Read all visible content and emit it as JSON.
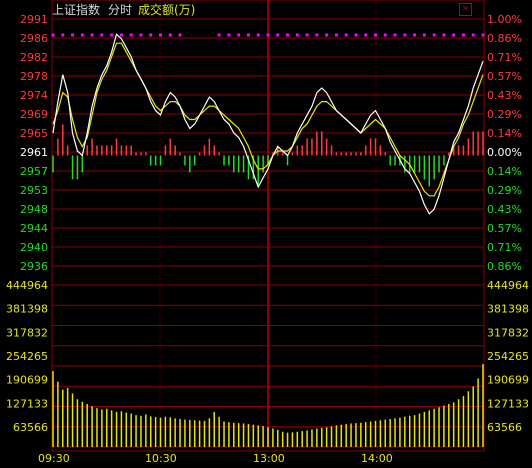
{
  "header": {
    "index_name": "上证指数",
    "mode": "分时",
    "volume_label": "成交额(万)",
    "close_glyph": "×"
  },
  "colors": {
    "background": "#000000",
    "grid": "#8b0000",
    "up": "#ff3b3b",
    "down": "#22dd22",
    "neutral": "#ffffff",
    "price_line": "#ffffff",
    "avg_line": "#e8e800",
    "volume_bar": "#e6e600",
    "magenta_marker": "#ff00ff",
    "time_label": "#e6e619"
  },
  "chart_data": {
    "type": "line",
    "prev_close": 2961,
    "price_axis": [
      "2991",
      "2986",
      "2982",
      "2978",
      "2974",
      "2969",
      "2965",
      "2961",
      "2957",
      "2953",
      "2948",
      "2944",
      "2940",
      "2936"
    ],
    "percent_axis": [
      "1.00%",
      "0.86%",
      "0.71%",
      "0.57%",
      "0.43%",
      "0.29%",
      "0.14%",
      "0.00%",
      "0.14%",
      "0.29%",
      "0.43%",
      "0.57%",
      "0.71%",
      "0.86%"
    ],
    "volume_axis": [
      "444964",
      "381398",
      "317832",
      "254265",
      "190699",
      "127133",
      "63566"
    ],
    "volume_max": 508530,
    "x_axis": [
      "09:30",
      "10:30",
      "13:00",
      "14:00"
    ],
    "series": [
      {
        "type": "line",
        "values": [
          2966,
          2973,
          2979,
          2975,
          2966,
          2962,
          2961,
          2966,
          2972,
          2976,
          2979,
          2981,
          2984,
          2988,
          2987,
          2985,
          2983,
          2980,
          2978,
          2976,
          2973,
          2971,
          2970,
          2973,
          2975,
          2974,
          2972,
          2969,
          2967,
          2968,
          2970,
          2972,
          2974,
          2973,
          2971,
          2969,
          2968,
          2966,
          2965,
          2963,
          2960,
          2957,
          2954,
          2956,
          2958,
          2961,
          2963,
          2962,
          2961,
          2963,
          2966,
          2968,
          2970,
          2972,
          2975,
          2976,
          2975,
          2973,
          2971,
          2970,
          2969,
          2968,
          2967,
          2966,
          2968,
          2970,
          2971,
          2969,
          2967,
          2964,
          2962,
          2960,
          2958,
          2957,
          2955,
          2953,
          2950,
          2948,
          2949,
          2952,
          2956,
          2960,
          2964,
          2966,
          2969,
          2972,
          2976,
          2979,
          2982
        ]
      },
      {
        "type": "line",
        "values": [
          2968,
          2971,
          2975,
          2974,
          2969,
          2965,
          2963,
          2965,
          2970,
          2975,
          2978,
          2980,
          2983,
          2986,
          2986,
          2984,
          2982,
          2980,
          2978,
          2976,
          2974,
          2972,
          2971,
          2972,
          2973,
          2973,
          2972,
          2970,
          2969,
          2969,
          2970,
          2971,
          2972,
          2972,
          2971,
          2970,
          2969,
          2968,
          2967,
          2965,
          2963,
          2960,
          2958,
          2958,
          2959,
          2961,
          2962,
          2962,
          2962,
          2963,
          2965,
          2967,
          2968,
          2970,
          2972,
          2973,
          2973,
          2972,
          2971,
          2970,
          2969,
          2968,
          2967,
          2966,
          2967,
          2968,
          2969,
          2968,
          2967,
          2965,
          2963,
          2961,
          2960,
          2959,
          2957,
          2955,
          2953,
          2952,
          2952,
          2954,
          2957,
          2960,
          2963,
          2965,
          2968,
          2970,
          2973,
          2976,
          2979
        ]
      },
      {
        "type": "bar",
        "values": [
          238000,
          205000,
          180000,
          185000,
          168000,
          150000,
          142000,
          135000,
          128000,
          122000,
          118000,
          120000,
          115000,
          110000,
          112000,
          108000,
          105000,
          100000,
          98000,
          102000,
          96000,
          94000,
          92000,
          95000,
          93000,
          90000,
          88000,
          86000,
          85000,
          84000,
          83000,
          82000,
          90000,
          110000,
          95000,
          80000,
          78000,
          76000,
          75000,
          74000,
          72000,
          70000,
          68000,
          66000,
          62000,
          58000,
          54000,
          48000,
          45000,
          46000,
          48000,
          50000,
          52000,
          55000,
          58000,
          60000,
          62000,
          65000,
          68000,
          70000,
          72000,
          74000,
          75000,
          76000,
          78000,
          80000,
          82000,
          84000,
          86000,
          88000,
          90000,
          92000,
          95000,
          98000,
          100000,
          105000,
          110000,
          115000,
          120000,
          125000,
          130000,
          135000,
          140000,
          150000,
          160000,
          175000,
          190000,
          215000,
          260000
        ]
      }
    ]
  }
}
